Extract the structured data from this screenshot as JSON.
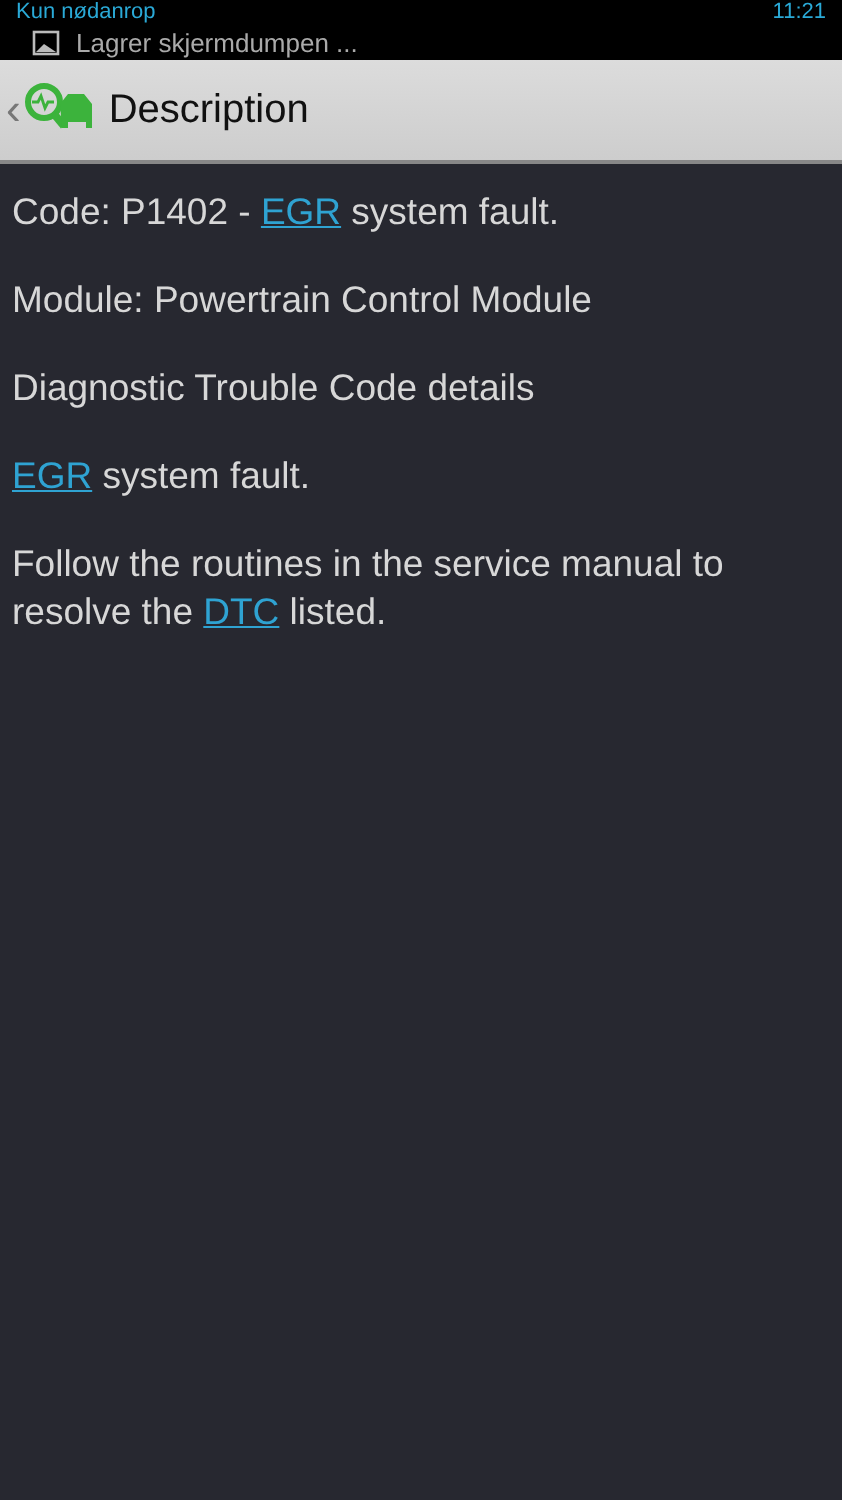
{
  "status_bar": {
    "carrier": "Kun nødanrop",
    "time": "11:21",
    "notification": "Lagrer skjermdumpen ..."
  },
  "header": {
    "back": "‹",
    "title": "Description"
  },
  "paragraphs": [
    [
      {
        "text": "Code: P1402 - ",
        "link": false
      },
      {
        "text": "EGR",
        "link": true
      },
      {
        "text": " system fault.",
        "link": false
      }
    ],
    [
      {
        "text": "Module: Powertrain Control Module",
        "link": false
      }
    ],
    [
      {
        "text": "Diagnostic Trouble Code details",
        "link": false
      }
    ],
    [
      {
        "text": "EGR",
        "link": true
      },
      {
        "text": " system fault.",
        "link": false
      }
    ],
    [
      {
        "text": "Follow the routines in the service manual to resolve the ",
        "link": false
      },
      {
        "text": "DTC",
        "link": true
      },
      {
        "text": " listed.",
        "link": false
      }
    ]
  ]
}
